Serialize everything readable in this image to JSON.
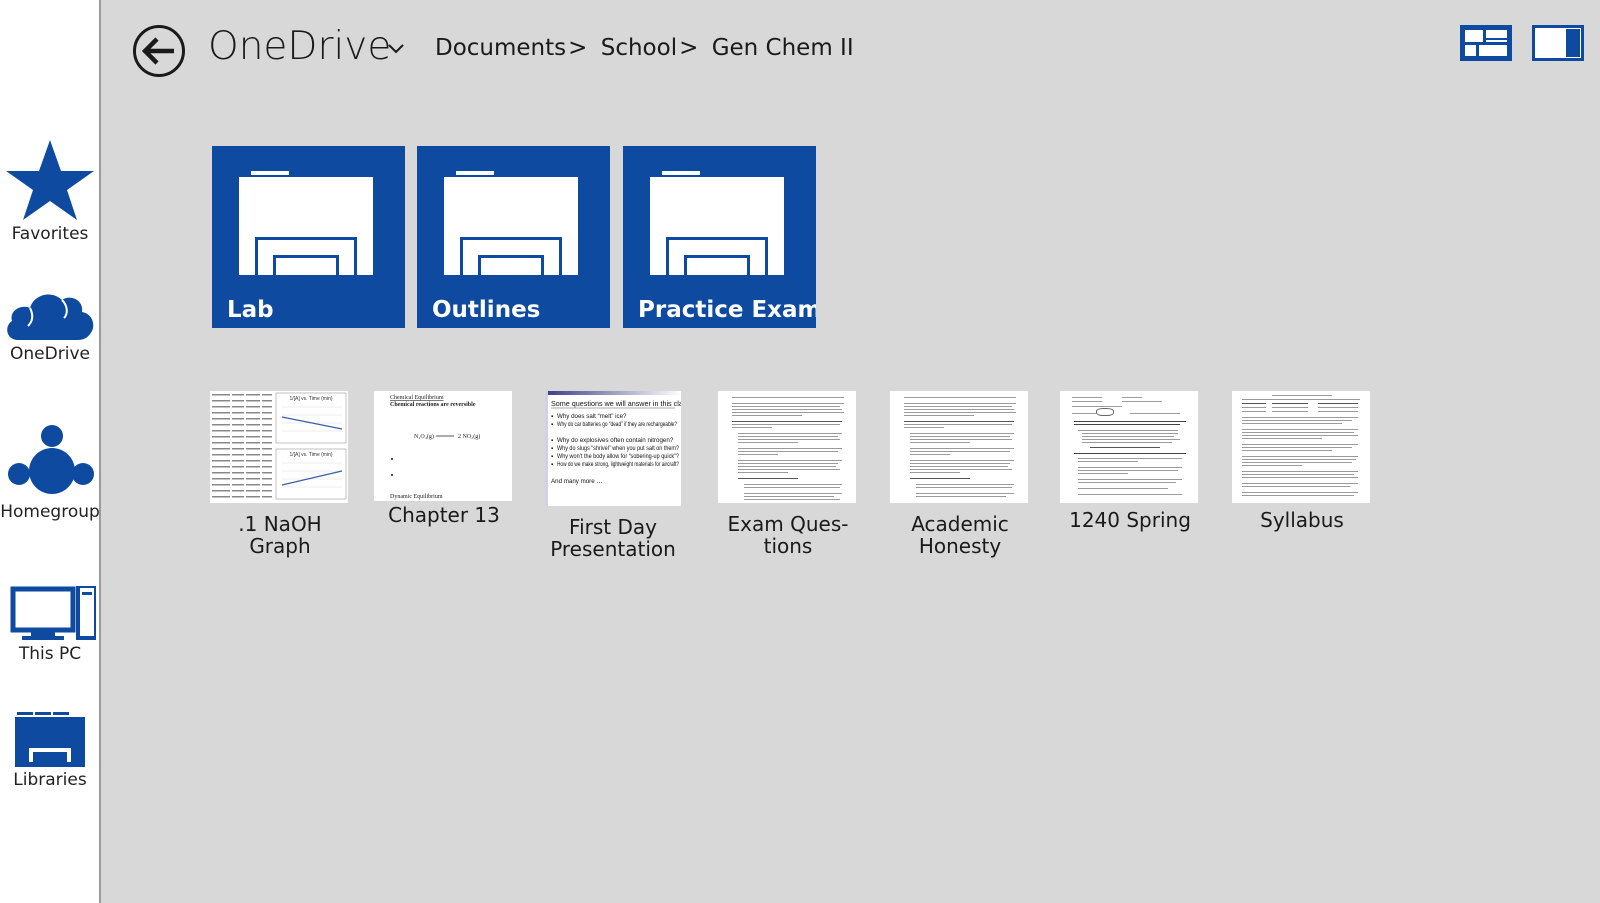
{
  "sidebar": {
    "items": [
      {
        "label": "Favorites",
        "icon": "star-icon"
      },
      {
        "label": "OneDrive",
        "icon": "cloud-icon"
      },
      {
        "label": "Homegroup",
        "icon": "homegroup-icon"
      },
      {
        "label": "This PC",
        "icon": "computer-icon"
      },
      {
        "label": "Libraries",
        "icon": "library-icon"
      }
    ]
  },
  "header": {
    "title": "OneDrive",
    "breadcrumb": [
      "Documents",
      "School",
      "Gen Chem II"
    ],
    "separator": ">"
  },
  "folders": [
    {
      "label": "Lab"
    },
    {
      "label": "Outlines"
    },
    {
      "label": "Practice Exams"
    }
  ],
  "files": [
    {
      "line1": ".1 NaOH",
      "line2": "Graph"
    },
    {
      "line1": "Chapter 13",
      "line2": ""
    },
    {
      "line1": "First Day",
      "line2": "Presentation"
    },
    {
      "line1": "Exam Ques-",
      "line2": "tions"
    },
    {
      "line1": "Academic",
      "line2": "Honesty"
    },
    {
      "line1": "1240 Spring",
      "line2": ""
    },
    {
      "line1": "Syllabus",
      "line2": ""
    }
  ],
  "thumbnails": {
    "graph_title_1": "1/[A] vs. Time (min)",
    "graph_title_2": "1/[A] vs. Time (min)",
    "chapter13_title": "Chemical Equilibrium",
    "chapter13_sub": "Chemical reactions are reversible",
    "chapter13_eq_left": "N₂O₄(g)",
    "chapter13_eq_right": "2 NO₂(g)",
    "chapter13_footer": "Dynamic Equilibrium",
    "presentation_heading": "Some questions we will answer in this class:",
    "presentation_bullets": [
      "Why does salt “melt” ice?",
      "Why do car batteries go “dead” if they are rechargeable?",
      "Why do explosives often contain nitrogen?",
      "Why do slugs “shrivel” when you put salt on them?",
      "Why won’t the body allow for “sobering-up quick”?",
      "How do we make strong, lightweight materials for aircraft?"
    ],
    "presentation_more": "And many more …"
  },
  "colors": {
    "tile": "#0d4aa0",
    "icon_blue": "#0d4aa0",
    "background": "#d8d8d8",
    "sidebar": "#ffffff"
  }
}
